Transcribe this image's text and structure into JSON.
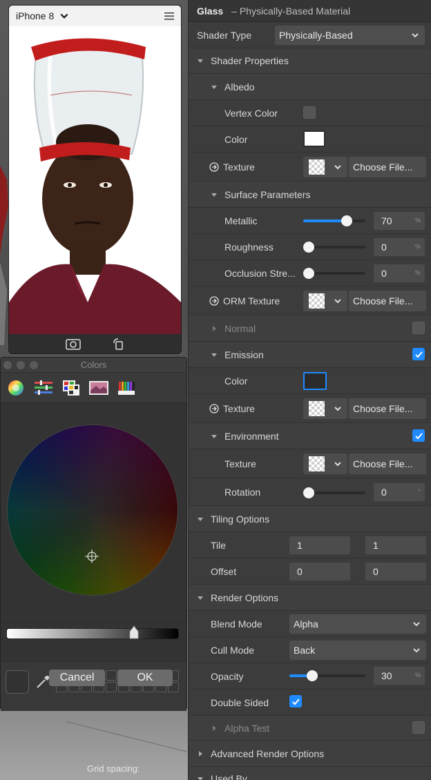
{
  "device": {
    "name": "iPhone 8"
  },
  "colors_panel": {
    "title": "Colors",
    "cancel_label": "Cancel",
    "ok_label": "OK"
  },
  "viewport": {
    "grid_label": "Grid spacing:"
  },
  "inspector": {
    "title": "Glass",
    "subtitle": "– Physically-Based Material",
    "shader_type_label": "Shader Type",
    "shader_type_value": "Physically-Based",
    "shader_properties_label": "Shader Properties",
    "albedo": {
      "label": "Albedo",
      "vertex_color_label": "Vertex Color",
      "color_label": "Color",
      "color_value": "#ffffff",
      "texture_label": "Texture",
      "choose_file": "Choose File..."
    },
    "surface": {
      "label": "Surface Parameters",
      "metallic_label": "Metallic",
      "metallic_value": "70",
      "roughness_label": "Roughness",
      "roughness_value": "0",
      "occlusion_label": "Occlusion Stre...",
      "occlusion_value": "0",
      "unit": "%",
      "orm_label": "ORM Texture",
      "choose_file": "Choose File..."
    },
    "normal_label": "Normal",
    "emission": {
      "label": "Emission",
      "color_label": "Color",
      "color_value": "#2b2b2b",
      "texture_label": "Texture",
      "choose_file": "Choose File..."
    },
    "environment": {
      "label": "Environment",
      "texture_label": "Texture",
      "choose_file": "Choose File...",
      "rotation_label": "Rotation",
      "rotation_value": "0",
      "rotation_unit": "°"
    },
    "tiling": {
      "label": "Tiling Options",
      "tile_label": "Tile",
      "tile_x": "1",
      "tile_y": "1",
      "offset_label": "Offset",
      "offset_x": "0",
      "offset_y": "0"
    },
    "render": {
      "label": "Render Options",
      "blend_mode_label": "Blend Mode",
      "blend_mode_value": "Alpha",
      "cull_mode_label": "Cull Mode",
      "cull_mode_value": "Back",
      "opacity_label": "Opacity",
      "opacity_value": "30",
      "opacity_unit": "%",
      "double_sided_label": "Double Sided"
    },
    "alpha_test_label": "Alpha Test",
    "advanced_render_label": "Advanced Render Options",
    "used_by_label": "Used By"
  },
  "colors": {
    "accent": "#1f8bff",
    "panel_bg": "#3c3c3c"
  }
}
